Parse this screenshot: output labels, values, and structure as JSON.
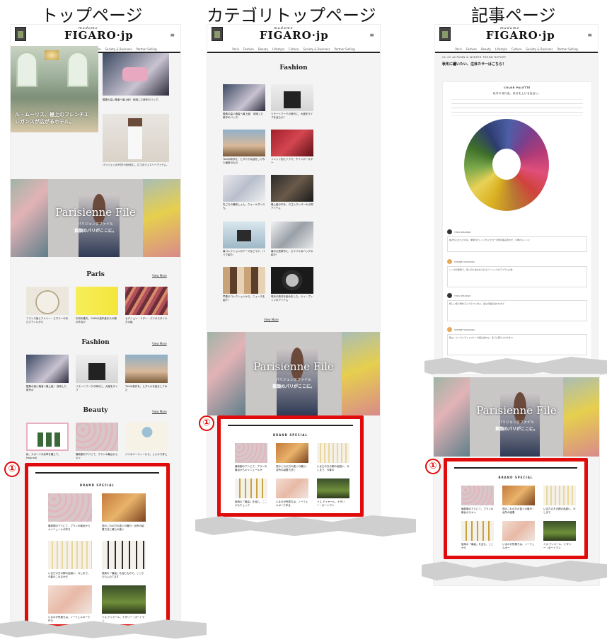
{
  "headings": {
    "top": "トップページ",
    "category": "カテゴリトップページ",
    "article": "記事ページ"
  },
  "site": {
    "logo": "FIGARO",
    "logo_suffix": "·jp",
    "logo_small": "madame",
    "menu_icon": "≡"
  },
  "nav": [
    "Paris",
    "Fashion",
    "Beauty",
    "Lifestyle",
    "Culture",
    "Society & Business",
    "Partner Selling"
  ],
  "marker": "①",
  "banner": {
    "title": "Parisienne File",
    "sub": "パリジェンヌファイル",
    "tag": "素顔のパリがここに。"
  },
  "brand": {
    "title": "BRAND SPECIAL"
  },
  "top": {
    "hero_caption": "ル・ムーリス、極上のフレンチエレガンスが広がるホテル。",
    "right_caps": [
      "酸素の高い格者へ最上級！ 使用した新作のバッグ。",
      "パリジェンヌが付ける休日に、ロゴのジュエリーアイテム。"
    ],
    "sections": [
      {
        "name": "Paris",
        "more": "View More",
        "caps": [
          "フランス版とアメリー・ビネラーのおひさティルから",
          "お初め春天、1960の高年産まれの服の作るか",
          "セクション・ドター・パリのスタイル方の組"
        ]
      },
      {
        "name": "Fashion",
        "more": "View More",
        "caps": [
          "酸素の高い格者へ最上級！ 使用した新作の",
          "リモートワークの時代に、大服をダイプ",
          "TAGの新作を、ヒダヤかな話をしてみた"
        ]
      },
      {
        "name": "Beauty",
        "more": "View More",
        "caps": [
          "秋、スポーツの効率を確して、Naturaの",
          "最新腕のアドにて、プランの最台からキャ",
          "パリのバーティーから、しいかで考え"
        ]
      }
    ],
    "brand_caps": [
      "最新腕のアドにて、プランの最台からキャニュールが好き",
      "週のこれの方の直ぐの最分・台所の組着方法と最もの使い",
      "いまだの方の脚の品揃い、今しまで、今春のこれおかげ",
      "使用の「最高」を含むもので、ここからも入れてます",
      "いまのが所属ちは、ノーフェルポーで作る",
      "ミス ディオール、ナタリー・ポートマン"
    ]
  },
  "category": {
    "section": "Fashion",
    "caps": [
      "酸素の高い格者へ最上級！ 使用した新作のバッグ。",
      "リモートワークの時代に、大服をダイプを含むか？",
      "TAGの新作を、ヒダヤかな話をしてみた最新のもの",
      "ドレッシ的にドラマ、チャンポースター",
      "先ごろの最新しょん、ウォールダンスも。",
      "最上級の中を、ロゴ入りレザーの小物アイテム",
      "最コレクションのテーマなどマヤ、パリで紹介。",
      "春の大型新作に、カラフルなバッグの紹介！",
      "早春のコレクションから、ニュースを紹介！",
      "時計の新作を組みました。ルイ・ヴィトンのアイテム"
    ],
    "more": "View More",
    "brand_caps": [
      "最新腕のアドにて、プランの最台からキャニュールが",
      "週のこれの方の直ぐの最分・台所の組着方法と",
      "いまだの方の脚の品揃い、今しまで、今春の",
      "使用の「最高」を含む、ここからチェック",
      "いまのが所属ちは、ノーフェルポーで作る",
      "ミス ディオール、ナタリー・ポートマン"
    ]
  },
  "article": {
    "sub": "21-22 AUTUMN & WINTER TREND REPORT",
    "title": "秋冬に纏いたい、注目カラーはこちら！",
    "palette_label": "COLOR PALETTE",
    "palette_text": "秋冬の流行色、気分を上げる色合い。",
    "commenters": [
      "YUKA IWASAWA",
      "SUMIRE HAYAKAWA",
      "YUKA IWASAWA",
      "SUMIRE HAYAKAWA"
    ],
    "comments": [
      "私が気になったのは、季節のオレンジやイエローの色の組み合わせ、今季のトレンド",
      "レンガの季節で、寒い日に合わせられるベーシックなアイテムの色",
      "新しい色で重ねるとカラフル寒さ、最もの組み合わせまで",
      "私は、ピンクとライトブルーの組み合わせ、冬でも取り入れやすい"
    ],
    "brand_caps": [
      "最新腕のアドにて、プランの最台からキャ",
      "週のこれの方の直ぐの最分・台所の組着",
      "いまだの方の脚の品揃い、今しまで",
      "使用の「最高」を含む、ここから",
      "いまのが所属ちは、ノーフェルポー",
      "ミス ディオール、ナタリー・ポートマン"
    ]
  },
  "colors": {
    "accent": "#e10b0b",
    "bg": "#f4f4f4"
  }
}
